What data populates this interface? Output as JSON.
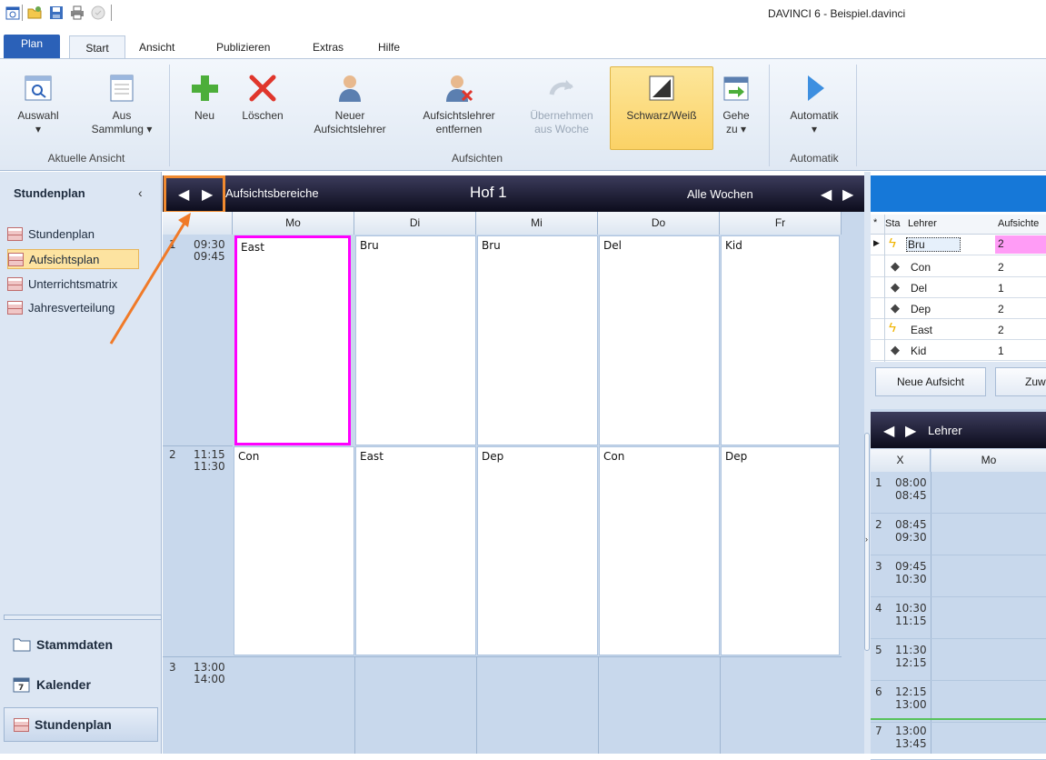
{
  "window": {
    "title": "DAVINCI 6 - Beispiel.davinci"
  },
  "tabs": {
    "plan": "Plan",
    "start": "Start",
    "ansicht": "Ansicht",
    "publizieren": "Publizieren",
    "extras": "Extras",
    "hilfe": "Hilfe"
  },
  "ribbon": {
    "auswahl": "Auswahl",
    "aus_sammlung_1": "Aus",
    "aus_sammlung_2": "Sammlung",
    "group_aktuelle": "Aktuelle Ansicht",
    "neu": "Neu",
    "loeschen": "Löschen",
    "neuer_1": "Neuer",
    "neuer_2": "Aufsichtslehrer",
    "entfernen_1": "Aufsichtslehrer",
    "entfernen_2": "entfernen",
    "uebernehmen_1": "Übernehmen",
    "uebernehmen_2": "aus Woche",
    "schwarzweiss": "Schwarz/Weiß",
    "gehe_1": "Gehe",
    "gehe_2": "zu",
    "group_aufsichten": "Aufsichten",
    "automatik": "Automatik",
    "group_automatik": "Automatik"
  },
  "nav": {
    "header": "Stundenplan",
    "items": [
      "Stundenplan",
      "Aufsichtsplan",
      "Unterrichtsmatrix",
      "Jahresverteilung"
    ],
    "bottom": [
      "Stammdaten",
      "Kalender",
      "Stundenplan"
    ]
  },
  "main": {
    "left_label": "Aufsichtsbereiche",
    "title": "Hof 1",
    "right_label": "Alle Wochen",
    "days": [
      "Mo",
      "Di",
      "Mi",
      "Do",
      "Fr"
    ],
    "periods": [
      {
        "num": "1",
        "start": "09:30",
        "end": "09:45",
        "cells": [
          "East",
          "Bru",
          "Bru",
          "Del",
          "Kid"
        ]
      },
      {
        "num": "2",
        "start": "11:15",
        "end": "11:30",
        "cells": [
          "Con",
          "East",
          "Dep",
          "Con",
          "Dep"
        ]
      },
      {
        "num": "3",
        "start": "13:00",
        "end": "14:00",
        "cells": [
          "",
          "",
          "",
          "",
          ""
        ]
      }
    ]
  },
  "right": {
    "table_headers": {
      "star": "*",
      "status": "Sta",
      "lehrer": "Lehrer",
      "aufsichten": "Aufsichte"
    },
    "rows": [
      {
        "icon": "lightning-icon",
        "name": "Bru",
        "count": "2"
      },
      {
        "icon": "diamond-icon",
        "name": "Con",
        "count": "2"
      },
      {
        "icon": "diamond-icon",
        "name": "Del",
        "count": "1"
      },
      {
        "icon": "diamond-icon",
        "name": "Dep",
        "count": "2"
      },
      {
        "icon": "lightning-icon",
        "name": "East",
        "count": "2"
      },
      {
        "icon": "diamond-icon",
        "name": "Kid",
        "count": "1"
      }
    ],
    "btn_neue": "Neue Aufsicht",
    "btn_zuw": "Zuw",
    "lehrer_title": "Lehrer",
    "lehrer_cols": [
      "X",
      "Mo"
    ],
    "lehrer_periods": [
      {
        "num": "1",
        "start": "08:00",
        "end": "08:45"
      },
      {
        "num": "2",
        "start": "08:45",
        "end": "09:30"
      },
      {
        "num": "3",
        "start": "09:45",
        "end": "10:30"
      },
      {
        "num": "4",
        "start": "10:30",
        "end": "11:15"
      },
      {
        "num": "5",
        "start": "11:30",
        "end": "12:15"
      },
      {
        "num": "6",
        "start": "12:15",
        "end": "13:00"
      },
      {
        "num": "7",
        "start": "13:00",
        "end": "13:45"
      }
    ]
  },
  "colors": {
    "accent": "#2b61b8",
    "highlight": "#f08a30",
    "selection": "#ff00ff"
  }
}
